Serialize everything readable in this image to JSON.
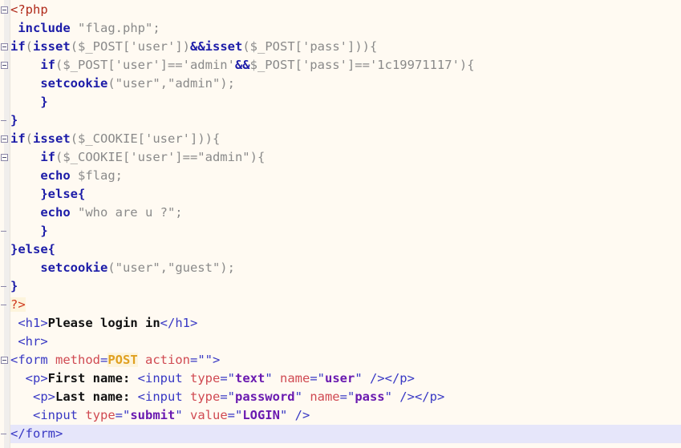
{
  "editor": {
    "language": "php",
    "background_color": "#fffaf2",
    "current_line_highlight_color": "#e6e6fa",
    "gutter_color": "#f0eeec",
    "line_height": 23,
    "first_line_top": 1
  },
  "colors": {
    "keyword": "#1c1ca8",
    "string": "#8a8a8a",
    "tag": "#3838c4",
    "php_open": "#b02a1a",
    "php_close": "#d03a20",
    "attribute": "#d04a52",
    "attribute_value": "#6a1ab0",
    "post_literal": "#e0a020",
    "plain_text": "#111111"
  },
  "code": {
    "lines": [
      {
        "index": 0,
        "fold": "box",
        "current": false,
        "tokens": [
          {
            "c": "t-php",
            "s": "<?php"
          }
        ]
      },
      {
        "index": 1,
        "fold": "none",
        "current": false,
        "tokens": [
          {
            "c": "t-plain",
            "s": " "
          },
          {
            "c": "t-kw",
            "s": "include"
          },
          {
            "c": "t-plain",
            "s": " \"flag.php\";"
          }
        ]
      },
      {
        "index": 2,
        "fold": "box",
        "current": false,
        "tokens": [
          {
            "c": "t-kw",
            "s": "if"
          },
          {
            "c": "t-plain",
            "s": "("
          },
          {
            "c": "t-kw",
            "s": "isset"
          },
          {
            "c": "t-plain",
            "s": "($_POST['user'])"
          },
          {
            "c": "t-kw",
            "s": "&&"
          },
          {
            "c": "t-kw",
            "s": "isset"
          },
          {
            "c": "t-plain",
            "s": "($_POST['pass'])){"
          }
        ]
      },
      {
        "index": 3,
        "fold": "box",
        "current": false,
        "tokens": [
          {
            "c": "t-plain",
            "s": "    "
          },
          {
            "c": "t-kw",
            "s": "if"
          },
          {
            "c": "t-plain",
            "s": "($_POST['user']=='admin'"
          },
          {
            "c": "t-kw",
            "s": "&&"
          },
          {
            "c": "t-plain",
            "s": "$_POST['pass']=='1c19971117'){"
          }
        ]
      },
      {
        "index": 4,
        "fold": "none",
        "current": false,
        "tokens": [
          {
            "c": "t-plain",
            "s": "    "
          },
          {
            "c": "t-kw",
            "s": "setcookie"
          },
          {
            "c": "t-plain",
            "s": "(\"user\",\"admin\");"
          }
        ]
      },
      {
        "index": 5,
        "fold": "none",
        "current": false,
        "tokens": [
          {
            "c": "t-plain",
            "s": "    "
          },
          {
            "c": "t-kw",
            "s": "}"
          }
        ]
      },
      {
        "index": 6,
        "fold": "dash",
        "current": false,
        "tokens": [
          {
            "c": "t-kw",
            "s": "}"
          }
        ]
      },
      {
        "index": 7,
        "fold": "box",
        "current": false,
        "tokens": [
          {
            "c": "t-kw",
            "s": "if"
          },
          {
            "c": "t-plain",
            "s": "("
          },
          {
            "c": "t-kw",
            "s": "isset"
          },
          {
            "c": "t-plain",
            "s": "($_COOKIE['user'])){"
          }
        ]
      },
      {
        "index": 8,
        "fold": "box",
        "current": false,
        "tokens": [
          {
            "c": "t-plain",
            "s": "    "
          },
          {
            "c": "t-kw",
            "s": "if"
          },
          {
            "c": "t-plain",
            "s": "($_COOKIE['user']==\"admin\"){"
          }
        ]
      },
      {
        "index": 9,
        "fold": "none",
        "current": false,
        "tokens": [
          {
            "c": "t-plain",
            "s": "    "
          },
          {
            "c": "t-kw",
            "s": "echo"
          },
          {
            "c": "t-plain",
            "s": " $flag;"
          }
        ]
      },
      {
        "index": 10,
        "fold": "none",
        "current": false,
        "tokens": [
          {
            "c": "t-plain",
            "s": "    "
          },
          {
            "c": "t-kw",
            "s": "}else{"
          }
        ]
      },
      {
        "index": 11,
        "fold": "none",
        "current": false,
        "tokens": [
          {
            "c": "t-plain",
            "s": "    "
          },
          {
            "c": "t-kw",
            "s": "echo"
          },
          {
            "c": "t-plain",
            "s": " \"who are u ?\";"
          }
        ]
      },
      {
        "index": 12,
        "fold": "dash",
        "current": false,
        "tokens": [
          {
            "c": "t-plain",
            "s": "    "
          },
          {
            "c": "t-kw",
            "s": "}"
          }
        ]
      },
      {
        "index": 13,
        "fold": "none",
        "current": false,
        "tokens": [
          {
            "c": "t-kw",
            "s": "}else{"
          }
        ]
      },
      {
        "index": 14,
        "fold": "none",
        "current": false,
        "tokens": [
          {
            "c": "t-plain",
            "s": "    "
          },
          {
            "c": "t-kw",
            "s": "setcookie"
          },
          {
            "c": "t-plain",
            "s": "(\"user\",\"guest\");"
          }
        ]
      },
      {
        "index": 15,
        "fold": "dash",
        "current": false,
        "tokens": [
          {
            "c": "t-kw",
            "s": "}"
          }
        ]
      },
      {
        "index": 16,
        "fold": "dash",
        "current": false,
        "tokens": [
          {
            "c": "t-phpend",
            "s": "?>"
          }
        ]
      },
      {
        "index": 17,
        "fold": "none",
        "current": false,
        "tokens": [
          {
            "c": "t-tag",
            "s": " <h1>"
          },
          {
            "c": "t-text",
            "s": "Please login in"
          },
          {
            "c": "t-tag",
            "s": "</h1>"
          }
        ]
      },
      {
        "index": 18,
        "fold": "none",
        "current": false,
        "tokens": [
          {
            "c": "t-tag",
            "s": " <hr>"
          }
        ]
      },
      {
        "index": 19,
        "fold": "box",
        "current": false,
        "tokens": [
          {
            "c": "t-tag",
            "s": "<form "
          },
          {
            "c": "t-attr",
            "s": "method"
          },
          {
            "c": "t-tag",
            "s": "="
          },
          {
            "c": "t-post",
            "s": "POST"
          },
          {
            "c": "t-tag",
            "s": " "
          },
          {
            "c": "t-attr",
            "s": "action"
          },
          {
            "c": "t-tag",
            "s": "=\"\">"
          }
        ]
      },
      {
        "index": 20,
        "fold": "none",
        "current": false,
        "tokens": [
          {
            "c": "t-tag",
            "s": "  <p>"
          },
          {
            "c": "t-text",
            "s": "First name: "
          },
          {
            "c": "t-tag",
            "s": "<input "
          },
          {
            "c": "t-attr",
            "s": "type"
          },
          {
            "c": "t-tag",
            "s": "=\""
          },
          {
            "c": "t-attrval",
            "s": "text"
          },
          {
            "c": "t-tag",
            "s": "\" "
          },
          {
            "c": "t-attr",
            "s": "name"
          },
          {
            "c": "t-tag",
            "s": "=\""
          },
          {
            "c": "t-attrval",
            "s": "user"
          },
          {
            "c": "t-tag",
            "s": "\" /></p>"
          }
        ]
      },
      {
        "index": 21,
        "fold": "none",
        "current": false,
        "tokens": [
          {
            "c": "t-tag",
            "s": "   <p>"
          },
          {
            "c": "t-text",
            "s": "Last name: "
          },
          {
            "c": "t-tag",
            "s": "<input "
          },
          {
            "c": "t-attr",
            "s": "type"
          },
          {
            "c": "t-tag",
            "s": "=\""
          },
          {
            "c": "t-attrval",
            "s": "password"
          },
          {
            "c": "t-tag",
            "s": "\" "
          },
          {
            "c": "t-attr",
            "s": "name"
          },
          {
            "c": "t-tag",
            "s": "=\""
          },
          {
            "c": "t-attrval",
            "s": "pass"
          },
          {
            "c": "t-tag",
            "s": "\" /></p>"
          }
        ]
      },
      {
        "index": 22,
        "fold": "none",
        "current": false,
        "tokens": [
          {
            "c": "t-tag",
            "s": "   <input "
          },
          {
            "c": "t-attr",
            "s": "type"
          },
          {
            "c": "t-tag",
            "s": "=\""
          },
          {
            "c": "t-attrval",
            "s": "submit"
          },
          {
            "c": "t-tag",
            "s": "\" "
          },
          {
            "c": "t-attr",
            "s": "value"
          },
          {
            "c": "t-tag",
            "s": "=\""
          },
          {
            "c": "t-attrval",
            "s": "LOGIN"
          },
          {
            "c": "t-tag",
            "s": "\" />"
          }
        ]
      },
      {
        "index": 23,
        "fold": "dash",
        "current": true,
        "tokens": [
          {
            "c": "t-tag",
            "s": "</form>"
          }
        ]
      }
    ]
  }
}
